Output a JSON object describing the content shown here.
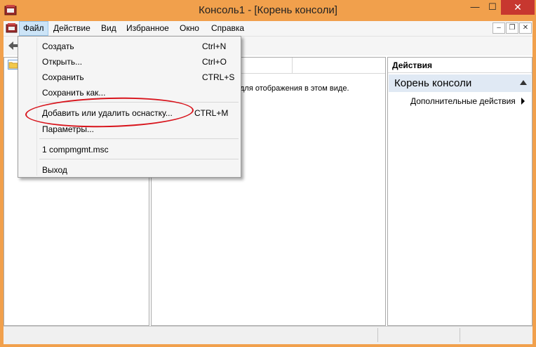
{
  "window": {
    "title": "Консоль1 - [Корень консоли]",
    "controls": {
      "minimize": "—",
      "maximize": "☐",
      "close": "✕"
    }
  },
  "menubar": {
    "items": [
      "Файл",
      "Действие",
      "Вид",
      "Избранное",
      "Окно",
      "Справка"
    ],
    "mdi_controls": {
      "minimize": "–",
      "restore": "❐",
      "close": "✕"
    }
  },
  "file_menu": {
    "items": [
      {
        "label": "Создать",
        "shortcut": "Ctrl+N"
      },
      {
        "label": "Открыть...",
        "shortcut": "Ctrl+O"
      },
      {
        "label": "Сохранить",
        "shortcut": "CTRL+S"
      },
      {
        "label": "Сохранить как...",
        "shortcut": ""
      },
      {
        "label": "Добавить или удалить оснастку...",
        "shortcut": "CTRL+M"
      },
      {
        "label": "Параметры...",
        "shortcut": ""
      },
      {
        "label": "1 compmgmt.msc",
        "shortcut": ""
      },
      {
        "label": "Выход",
        "shortcut": ""
      }
    ]
  },
  "middle_pane": {
    "empty_text": "для отображения в этом виде."
  },
  "actions_pane": {
    "title": "Действия",
    "group": "Корень консоли",
    "more": "Дополнительные действия"
  },
  "colors": {
    "title_bar": "#f1a04c",
    "close_button": "#c7372f",
    "highlight_ellipse": "#d8141c",
    "actions_group_bg": "#e0e9f4",
    "menu_active": "#cce4f7"
  }
}
